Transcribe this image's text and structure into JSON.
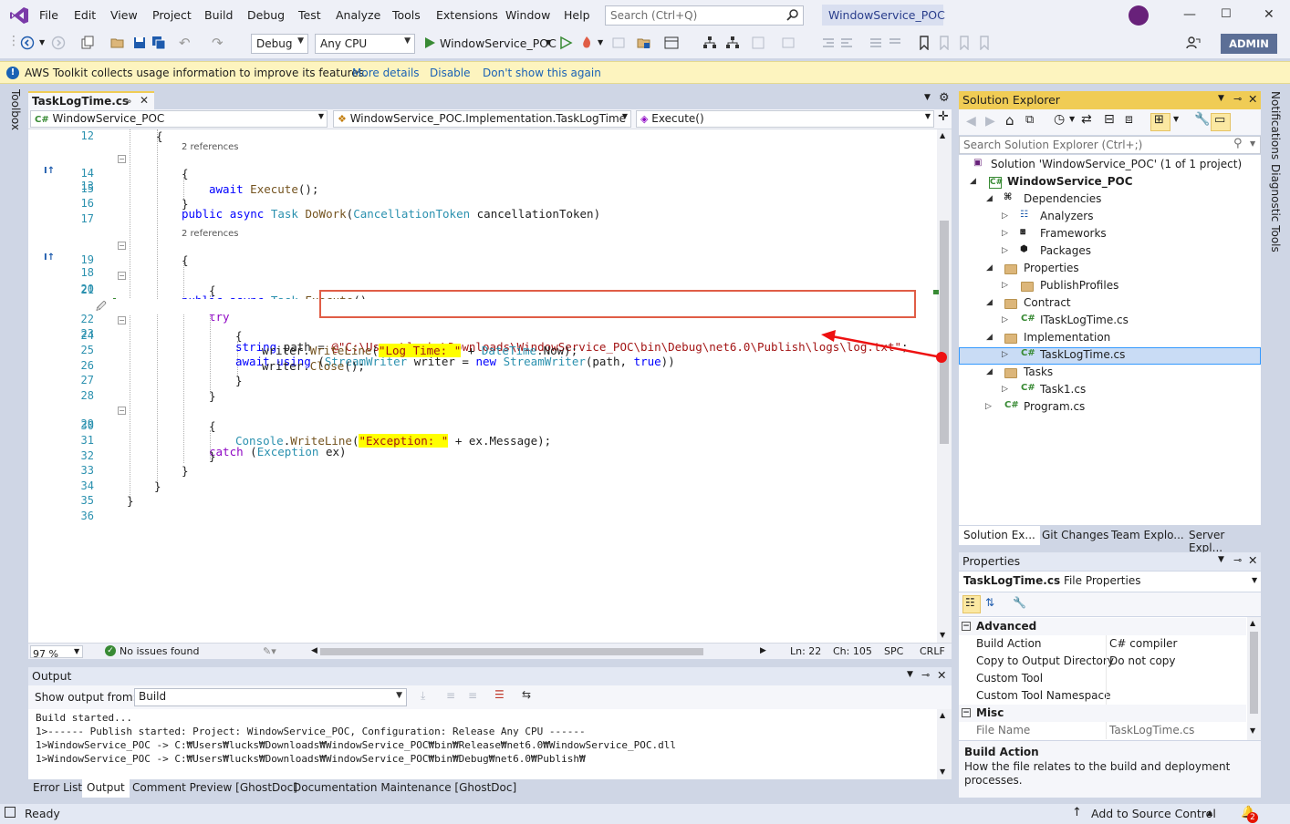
{
  "menu": [
    "File",
    "Edit",
    "View",
    "Project",
    "Build",
    "Debug",
    "Test",
    "Analyze",
    "Tools",
    "Extensions",
    "Window",
    "Help"
  ],
  "search": {
    "placeholder": "Search (Ctrl+Q)"
  },
  "solution_title": "WindowService_POC",
  "toolbar": {
    "config": "Debug",
    "platform": "Any CPU",
    "run_target": "WindowService_POC",
    "admin_label": "ADMIN"
  },
  "infobar": {
    "message": "AWS Toolkit collects usage information to improve its features.",
    "more_details": "More details",
    "disable": "Disable",
    "dont_show": "Don't show this again"
  },
  "toolbox_tab": "Toolbox",
  "editor": {
    "tab_name": "TaskLogTime.cs",
    "nav_project": "WindowService_POC",
    "nav_class": "WindowService_POC.Implementation.TaskLogTime",
    "nav_member": "Execute()",
    "zoom": "97 %",
    "issues": "No issues found",
    "ln": "Ln: 22",
    "ch": "Ch: 105",
    "spc": "SPC",
    "crlf": "CRLF",
    "refs_label": "2 references",
    "lines": [
      {
        "n": "12",
        "text": "{"
      },
      {
        "n": "13",
        "text": "public async Task DoWork(CancellationToken cancellationToken)"
      },
      {
        "n": "14",
        "text": "{"
      },
      {
        "n": "15",
        "text": "await Execute();"
      },
      {
        "n": "16",
        "text": "}"
      },
      {
        "n": "17",
        "text": ""
      },
      {
        "n": "18",
        "text": "public async Task Execute()"
      },
      {
        "n": "19",
        "text": "{"
      },
      {
        "n": "20",
        "text": "try"
      },
      {
        "n": "21",
        "text": "{"
      },
      {
        "n": "22",
        "text": "string path = @\"C:\\Users\\lucks\\Downloads\\WindowService_POC\\bin\\Debug\\net6.0\\Publish\\logs\\log.txt\";"
      },
      {
        "n": "23",
        "text": "await using (StreamWriter writer = new StreamWriter(path, true))"
      },
      {
        "n": "24",
        "text": "{"
      },
      {
        "n": "25",
        "text": "writer.WriteLine(\"Log Time: \" + DateTime.Now);"
      },
      {
        "n": "26",
        "text": "writer.Close();"
      },
      {
        "n": "27",
        "text": "}"
      },
      {
        "n": "28",
        "text": "}"
      },
      {
        "n": "29",
        "text": "catch (Exception ex)"
      },
      {
        "n": "30",
        "text": "{"
      },
      {
        "n": "31",
        "text": "Console.WriteLine(\"Exception: \" + ex.Message);"
      },
      {
        "n": "32",
        "text": "}"
      },
      {
        "n": "33",
        "text": "}"
      },
      {
        "n": "34",
        "text": "}"
      },
      {
        "n": "35",
        "text": "}"
      },
      {
        "n": "36",
        "text": ""
      }
    ]
  },
  "output": {
    "title": "Output",
    "show_from_label": "Show output from:",
    "source": "Build",
    "lines": [
      "Build started...",
      "1>------ Publish started: Project: WindowService_POC, Configuration: Release Any CPU ------",
      "1>WindowService_POC -> C:₩Users₩lucks₩Downloads₩WindowService_POC₩bin₩Release₩net6.0₩WindowService_POC.dll",
      "1>WindowService_POC -> C:₩Users₩lucks₩Downloads₩WindowService_POC₩bin₩Debug₩net6.0₩Publish₩"
    ],
    "tabs": [
      "Error List",
      "Output",
      "Comment Preview [GhostDoc]",
      "Documentation Maintenance [GhostDoc]"
    ]
  },
  "solution_explorer": {
    "title": "Solution Explorer",
    "search_placeholder": "Search Solution Explorer (Ctrl+;)",
    "tree": [
      {
        "label": "Solution 'WindowService_POC'  (1 of 1 project)",
        "indent": 0
      },
      {
        "label": "WindowService_POC",
        "indent": 1
      },
      {
        "label": "Dependencies",
        "indent": 2
      },
      {
        "label": "Analyzers",
        "indent": 3
      },
      {
        "label": "Frameworks",
        "indent": 3
      },
      {
        "label": "Packages",
        "indent": 3
      },
      {
        "label": "Properties",
        "indent": 2
      },
      {
        "label": "PublishProfiles",
        "indent": 3
      },
      {
        "label": "Contract",
        "indent": 2
      },
      {
        "label": "ITaskLogTime.cs",
        "indent": 3
      },
      {
        "label": "Implementation",
        "indent": 2
      },
      {
        "label": "TaskLogTime.cs",
        "indent": 3
      },
      {
        "label": "Tasks",
        "indent": 2
      },
      {
        "label": "Task1.cs",
        "indent": 3
      },
      {
        "label": "Program.cs",
        "indent": 2
      }
    ],
    "tabs": [
      "Solution Ex...",
      "Git Changes",
      "Team Explo...",
      "Server Expl..."
    ]
  },
  "properties": {
    "title": "Properties",
    "object_name": "TaskLogTime.cs",
    "object_type": "File Properties",
    "cat_advanced": "Advanced",
    "cat_misc": "Misc",
    "rows_advanced": [
      {
        "k": "Build Action",
        "v": "C# compiler"
      },
      {
        "k": "Copy to Output Directory",
        "v": "Do not copy"
      },
      {
        "k": "Custom Tool",
        "v": ""
      },
      {
        "k": "Custom Tool Namespace",
        "v": ""
      }
    ],
    "rows_misc": [
      {
        "k": "File Name",
        "v": "TaskLogTime.cs"
      }
    ],
    "desc_title": "Build Action",
    "desc_text": "How the file relates to the build and deployment processes."
  },
  "right_tabs": [
    "Notifications",
    "Diagnostic Tools"
  ],
  "status": {
    "ready": "Ready",
    "source_control": "Add to Source Control",
    "notif_count": "2"
  },
  "colors": {
    "accent": "#f0cc55",
    "annotation": "#e05d46",
    "vs_purple": "#68217a"
  }
}
